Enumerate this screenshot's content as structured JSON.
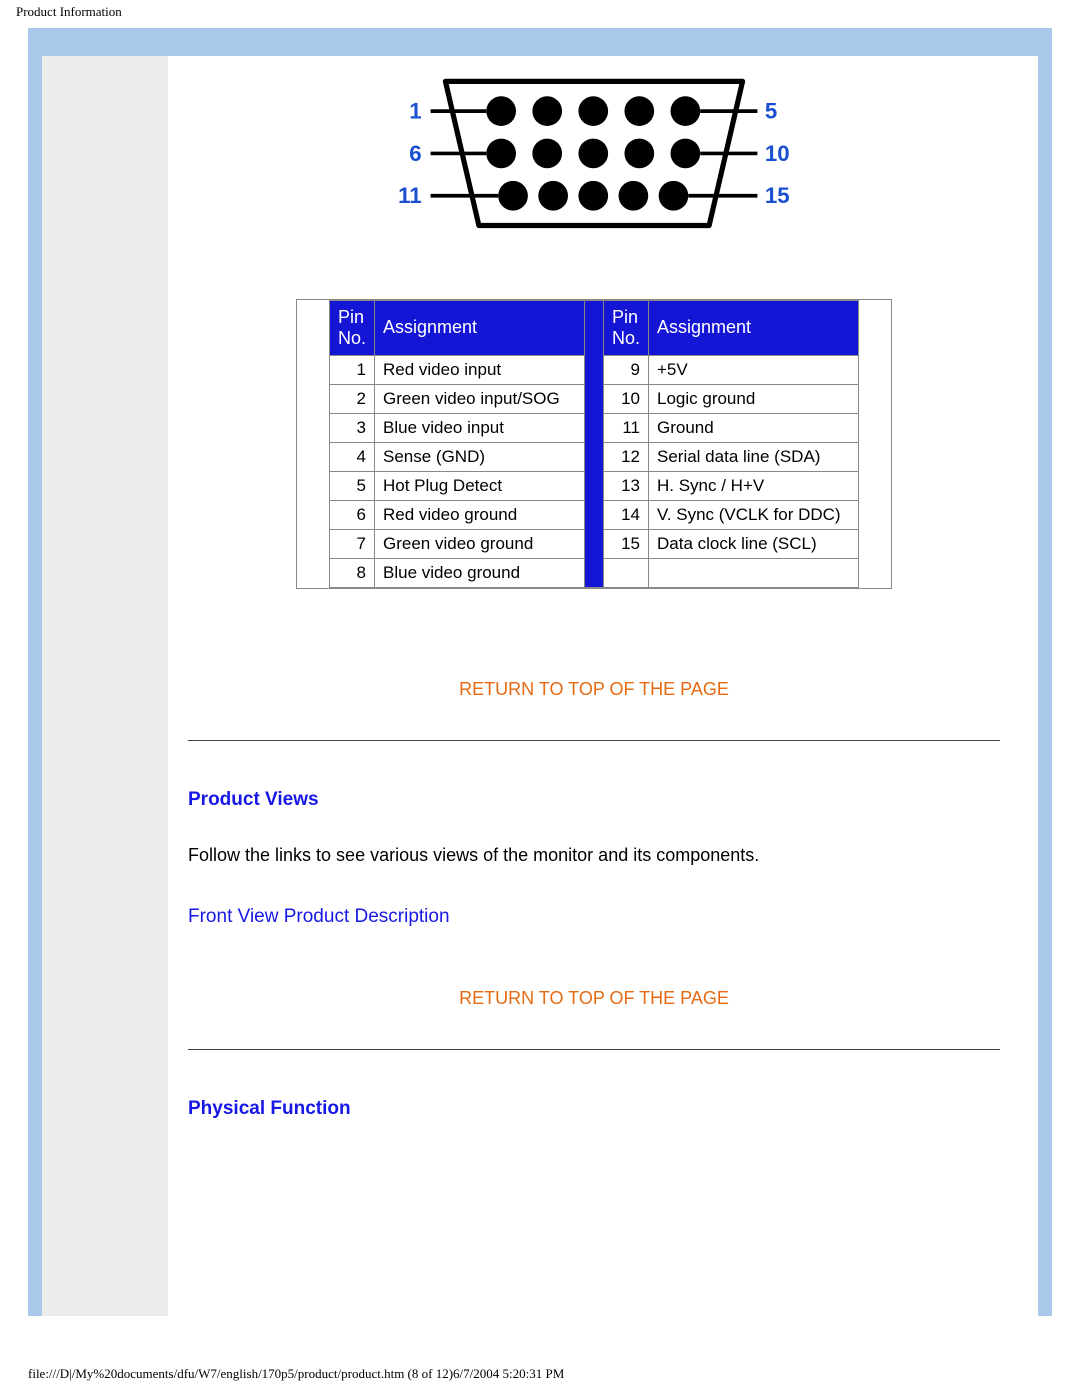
{
  "page_title": "Product Information",
  "diagram": {
    "labels": {
      "row1_left": "1",
      "row1_right": "5",
      "row2_left": "6",
      "row2_right": "10",
      "row3_left": "11",
      "row3_right": "15"
    }
  },
  "pinTable": {
    "headers": {
      "pin": "Pin No.",
      "assignment": "Assignment"
    },
    "left": [
      {
        "no": "1",
        "assignment": "Red video input"
      },
      {
        "no": "2",
        "assignment": "Green video input/SOG"
      },
      {
        "no": "3",
        "assignment": "Blue video input"
      },
      {
        "no": "4",
        "assignment": "Sense (GND)"
      },
      {
        "no": "5",
        "assignment": "Hot Plug Detect"
      },
      {
        "no": "6",
        "assignment": "Red video ground"
      },
      {
        "no": "7",
        "assignment": "Green video ground"
      },
      {
        "no": "8",
        "assignment": "Blue video ground"
      }
    ],
    "right": [
      {
        "no": "9",
        "assignment": "+5V"
      },
      {
        "no": "10",
        "assignment": "Logic ground"
      },
      {
        "no": "11",
        "assignment": "Ground"
      },
      {
        "no": "12",
        "assignment": "Serial data line (SDA)"
      },
      {
        "no": "13",
        "assignment": "H. Sync / H+V"
      },
      {
        "no": "14",
        "assignment": "V. Sync (VCLK for DDC)"
      },
      {
        "no": "15",
        "assignment": "Data clock line (SCL)"
      }
    ]
  },
  "links": {
    "return_top": "RETURN TO TOP OF THE PAGE",
    "front_view": "Front View Product Description"
  },
  "sections": {
    "product_views": {
      "heading": "Product Views",
      "body": "Follow the links to see various views of the monitor and its components."
    },
    "physical_function": {
      "heading": "Physical Function"
    }
  },
  "footer_path": "file:///D|/My%20documents/dfu/W7/english/170p5/product/product.htm (8 of 12)6/7/2004 5:20:31 PM"
}
